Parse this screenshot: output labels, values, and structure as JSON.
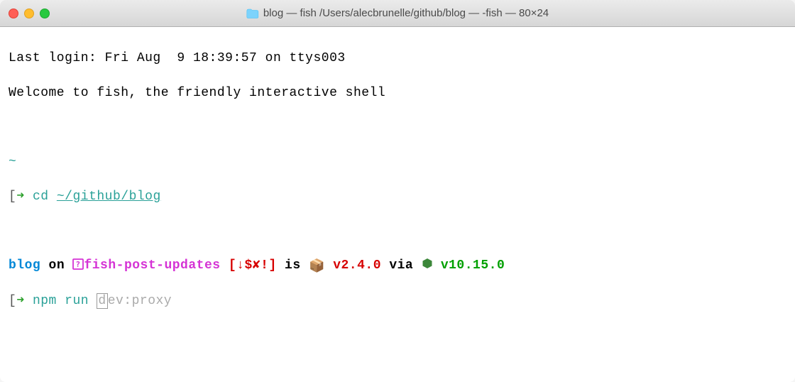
{
  "titlebar": {
    "title": "blog — fish /Users/alecbrunelle/github/blog — -fish — 80×24"
  },
  "terminal": {
    "last_login": "Last login: Fri Aug  9 18:39:57 on ttys003",
    "welcome": "Welcome to fish, the friendly interactive shell",
    "cwd_short": "~",
    "arrow": "➜ ",
    "open_bracket": "[",
    "close_bracket": "]",
    "cd_cmd": "cd ",
    "cd_path": "~/github/blog",
    "prompt2": {
      "dir": "blog",
      "on": " on ",
      "branch_icon": "⎇",
      "branch": "fish-post-updates",
      "git_open": " [",
      "git_status": "↓$✘!",
      "git_close": "]",
      "is": " is ",
      "pkg_version": " v2.4.0",
      "via": " via ",
      "node_version": " v10.15.0"
    },
    "current_cmd": {
      "typed": "npm run ",
      "cursor_char": "d",
      "suggestion_rest": "ev:proxy"
    }
  }
}
